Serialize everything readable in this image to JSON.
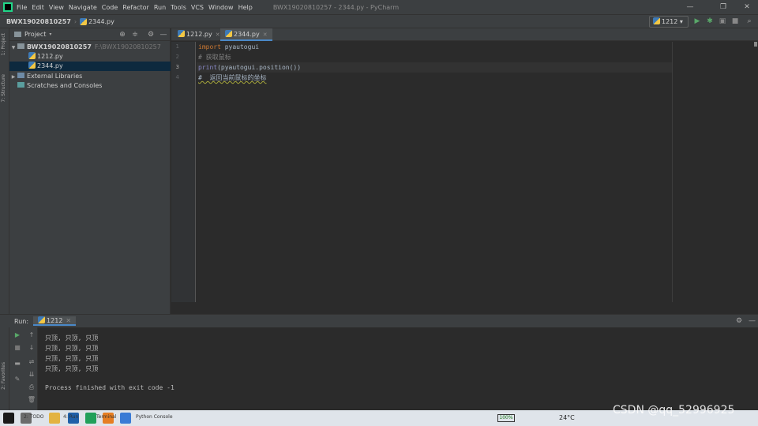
{
  "menubar": {
    "items": [
      "File",
      "Edit",
      "View",
      "Navigate",
      "Code",
      "Refactor",
      "Run",
      "Tools",
      "VCS",
      "Window",
      "Help"
    ],
    "window_title": "BWX19020810257 - 2344.py - PyCharm"
  },
  "navbar": {
    "project": "BWX19020810257",
    "file": "2344.py",
    "run_config": "1212"
  },
  "project_panel": {
    "title": "Project",
    "root": {
      "name": "BWX19020810257",
      "path": "F:\\BWX19020810257"
    },
    "files": [
      "1212.py",
      "2344.py"
    ],
    "external_libraries": "External Libraries",
    "scratches": "Scratches and Consoles"
  },
  "left_stripe": {
    "project_label": "1: Project",
    "structure_label": "7: Structure",
    "favorites_label": "2: Favorites"
  },
  "editor": {
    "tabs": [
      "1212.py",
      "2344.py"
    ],
    "active_tab": "2344.py",
    "line_numbers": [
      "1",
      "2",
      "3",
      "4"
    ],
    "lines": {
      "l1_kw": "import",
      "l1_mod": " pyautogui",
      "l2": "# 获取鼠标",
      "l3_fn": "print",
      "l3_rest": "(pyautogui.position())",
      "l4": "#  返回当前鼠标的坐标"
    }
  },
  "run_panel": {
    "label": "Run:",
    "tab": "1212",
    "output": [
      "只顶, 只顶, 只顶",
      "只顶, 只顶, 只顶",
      "只顶, 只顶, 只顶",
      "只顶, 只顶, 只顶",
      "",
      "Process finished with exit code -1"
    ]
  },
  "taskbar": {
    "items": [
      "2: TODO",
      "4: Run",
      "Terminal",
      "Python Console"
    ],
    "temperature": "24°C",
    "battery": "100%"
  },
  "watermark": "CSDN @qq_52996925",
  "colors": {
    "accent": "#4a88c7",
    "run_green": "#59a869",
    "keyword": "#cc7832",
    "comment": "#808080",
    "builtin": "#8888c6"
  }
}
